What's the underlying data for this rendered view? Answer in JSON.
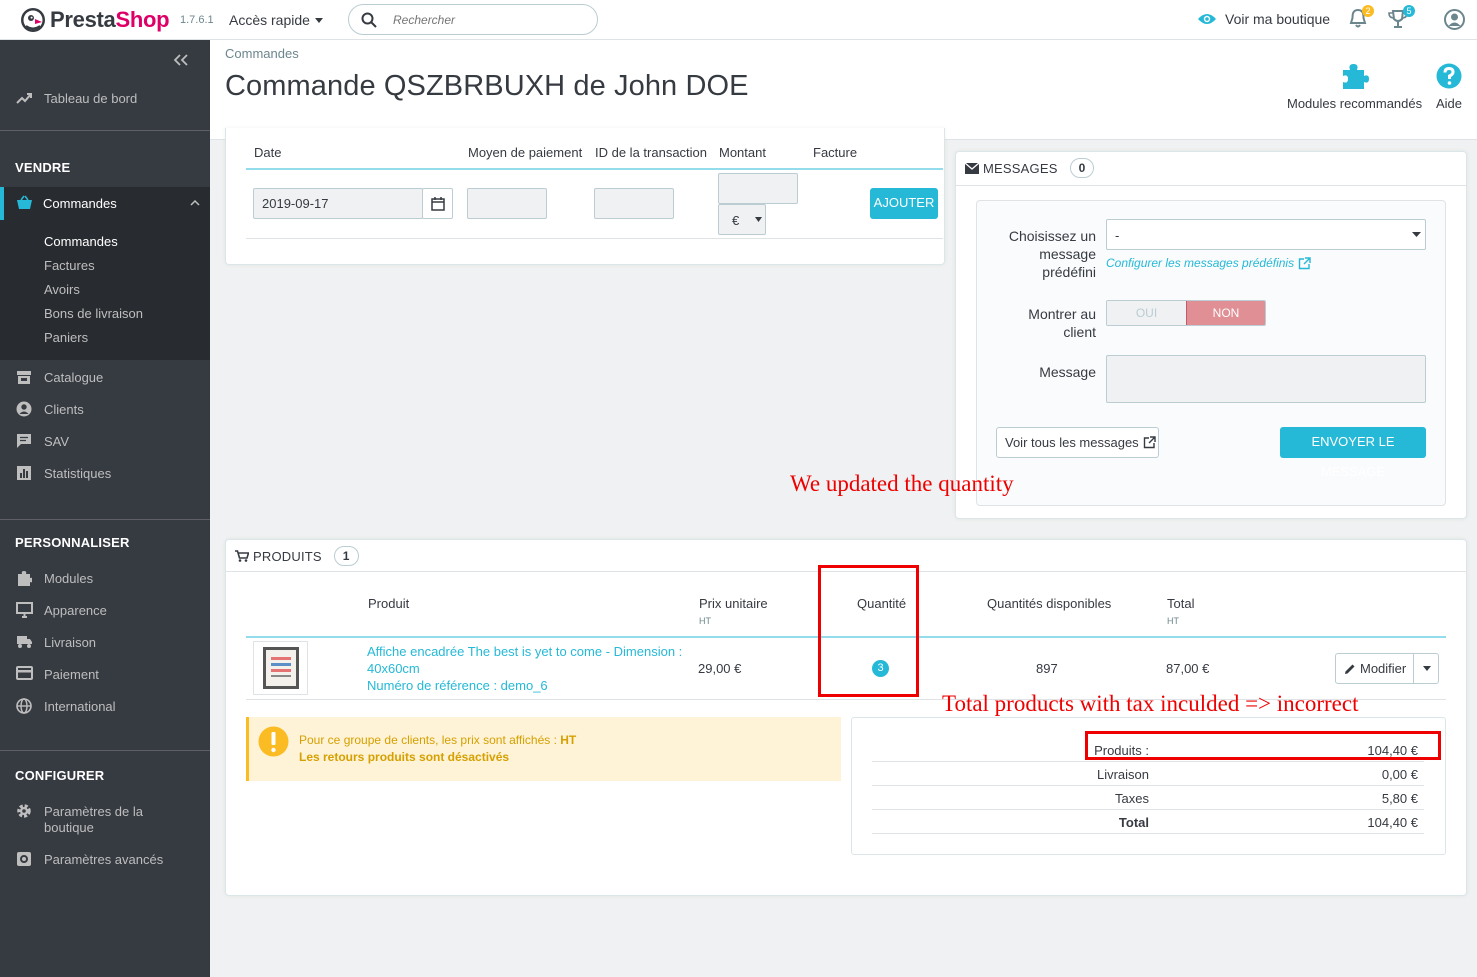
{
  "header": {
    "brand_part1": "Presta",
    "brand_part2": "Shop",
    "version": "1.7.6.1",
    "quick_access": "Accès rapide",
    "search_placeholder": "Rechercher",
    "view_shop": "Voir ma boutique",
    "notif_count_orders": "2",
    "notif_count_customers": "5"
  },
  "sidebar": {
    "dashboard": "Tableau de bord",
    "section_sell": "VENDRE",
    "orders": "Commandes",
    "sub_orders": "Commandes",
    "sub_invoices": "Factures",
    "sub_credit_slips": "Avoirs",
    "sub_delivery_slips": "Bons de livraison",
    "sub_carts": "Paniers",
    "catalog": "Catalogue",
    "customers": "Clients",
    "customer_service": "SAV",
    "stats": "Statistiques",
    "section_customize": "PERSONNALISER",
    "modules": "Modules",
    "design": "Apparence",
    "shipping": "Livraison",
    "payment": "Paiement",
    "international": "International",
    "section_configure": "CONFIGURER",
    "shop_params_line1": "Paramètres de la",
    "shop_params_line2": "boutique",
    "advanced_params": "Paramètres avancés"
  },
  "page": {
    "breadcrumb": "Commandes",
    "title": "Commande QSZBRBUXH de John DOE",
    "toolbar_modules": "Modules recommandés",
    "toolbar_help": "Aide"
  },
  "payment": {
    "col_date": "Date",
    "col_method": "Moyen de paiement",
    "col_transaction": "ID de la transaction",
    "col_amount": "Montant",
    "col_invoice": "Facture",
    "date_value": "2019-09-17",
    "currency": "€",
    "add_button": "AJOUTER"
  },
  "messages": {
    "title": "MESSAGES",
    "count": "0",
    "predefined_label_1": "Choisissez un",
    "predefined_label_2": "message",
    "predefined_label_3": "prédéfini",
    "predefined_value": "-",
    "configure_link": "Configurer les messages prédéfinis",
    "show_label_1": "Montrer au",
    "show_label_2": "client",
    "toggle_yes": "OUI",
    "toggle_no": "NON",
    "message_label": "Message",
    "view_all": "Voir tous les messages",
    "send": "ENVOYER LE MESSAGE"
  },
  "products": {
    "title": "PRODUITS",
    "count": "1",
    "col_product": "Produit",
    "col_unit_price": "Prix unitaire",
    "col_unit_price_sub": "HT",
    "col_quantity": "Quantité",
    "col_available": "Quantités disponibles",
    "col_total": "Total",
    "col_total_sub": "HT",
    "rows": [
      {
        "name_line1": "Affiche encadrée The best is yet to come - Dimension :",
        "name_line2": "40x60cm",
        "reference": "Numéro de référence : demo_6",
        "unit_price": "29,00 €",
        "quantity": "3",
        "available": "897",
        "total": "87,00 €",
        "edit": "Modifier"
      }
    ],
    "alert_line1_prefix": "Pour ce groupe de clients, les prix sont affichés : ",
    "alert_line1_bold": "HT",
    "alert_line2": "Les retours produits sont désactivés",
    "summary": [
      {
        "label": "Produits :",
        "value": "104,40 €"
      },
      {
        "label": "Livraison",
        "value": "0,00 €"
      },
      {
        "label": "Taxes",
        "value": "5,80 €"
      },
      {
        "label": "Total",
        "value": "104,40 €"
      }
    ]
  },
  "annotations": {
    "quantity_note": "We updated the quantity",
    "total_note": "Total products with tax inculded => incorrect"
  },
  "colors": {
    "accent": "#25b9d7",
    "brand_pink": "#df0067",
    "sidebar_bg": "#363a41",
    "annotation_red": "#e00000"
  }
}
